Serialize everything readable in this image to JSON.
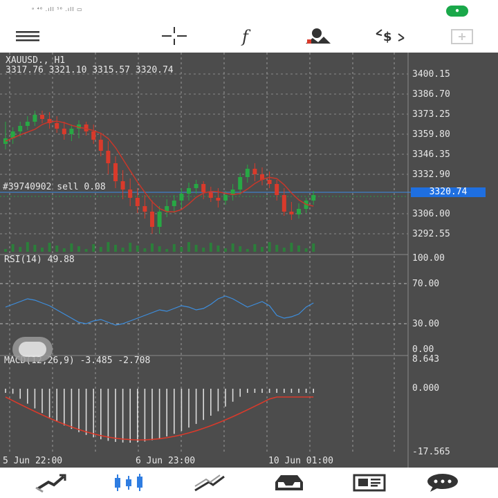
{
  "statusbar": {
    "text": "ᵃ ⁴⁶ .ıll ⁵⁶ .ıll ▭"
  },
  "toolbar": {
    "icons": [
      "menu-icon",
      "crosshair-icon",
      "indicators-icon",
      "objects-icon",
      "trade-icon",
      "add-window-icon"
    ]
  },
  "chart": {
    "symbol": "XAUUSD., H1",
    "ohlc": "3317.76 3321.10 3315.57 3320.74",
    "order_label": "#39740902 sell 0.08",
    "current_price": "3320.74",
    "price_ticks": [
      "3400.15",
      "3386.70",
      "3373.25",
      "3359.80",
      "3346.35",
      "3332.90",
      "3306.00",
      "3292.55"
    ],
    "date_labels": [
      "5 Jun 22:00",
      "6 Jun 23:00",
      "10 Jun 01:00"
    ],
    "up_color": "#27a844",
    "down_color": "#d93a2b",
    "background": "#4c4c4c"
  },
  "rsi": {
    "label": "RSI(14) 49.88",
    "levels": [
      "100.00",
      "70.00",
      "30.00",
      "0.00"
    ],
    "color": "#3d8fe0"
  },
  "macd": {
    "label": "MACD(12,26,9) -3.485 -2.708",
    "levels": [
      "8.643",
      "0.000",
      "-17.565"
    ],
    "signal_color": "#d93a2b",
    "hist_color": "#dcdcdc"
  },
  "bottomnav": {
    "icons": [
      "quotes-icon",
      "chart-icon",
      "trade-icon",
      "history-icon",
      "news-icon",
      "chat-icon"
    ],
    "active": "chart-icon"
  }
}
